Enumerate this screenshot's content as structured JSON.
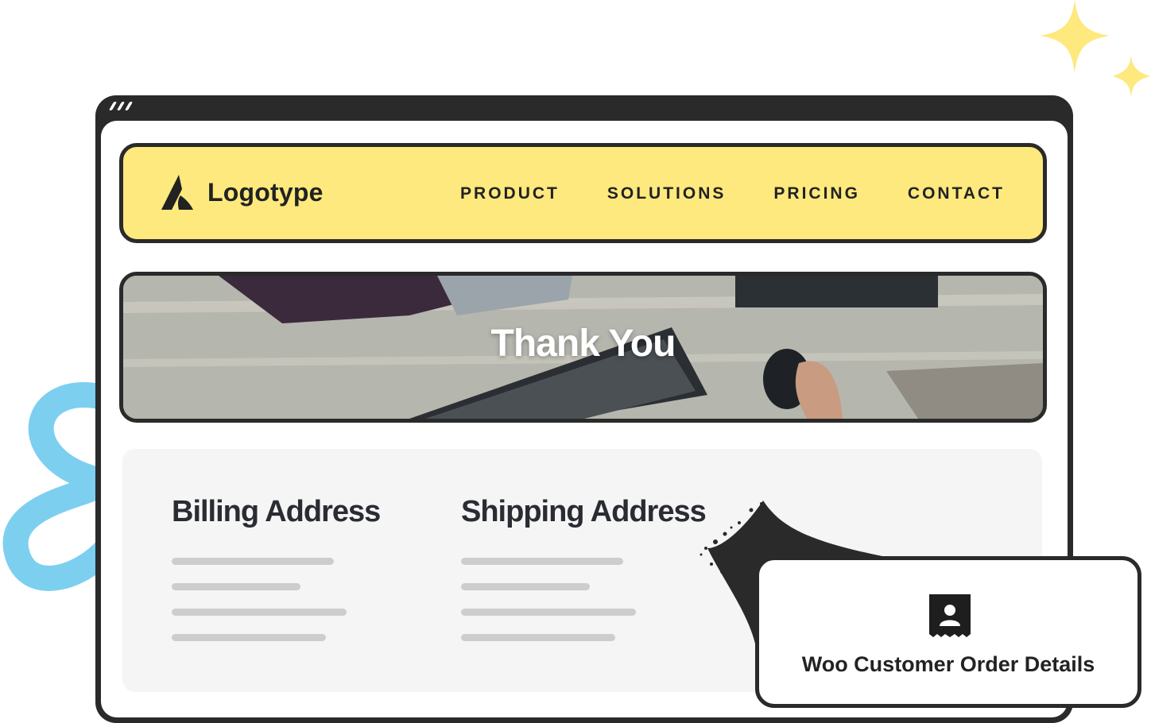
{
  "browser": {
    "window_dots": 3
  },
  "header": {
    "logo_text": "Logotype",
    "logo_icon": "logotype-mark-icon",
    "nav": [
      {
        "label": "PRODUCT"
      },
      {
        "label": "SOLUTIONS"
      },
      {
        "label": "PRICING"
      },
      {
        "label": "CONTACT"
      }
    ]
  },
  "hero": {
    "title": "Thank You",
    "background": "desk-keyboard-mouse-photo"
  },
  "addresses": {
    "billing": {
      "title": "Billing Address"
    },
    "shipping": {
      "title": "Shipping Address"
    }
  },
  "widget": {
    "label": "Woo Customer Order Details",
    "icon": "customer-receipt-icon"
  },
  "colors": {
    "nav_background": "#fde97d",
    "frame": "#2a2a2a",
    "panel": "#f5f5f5",
    "placeholder_lines": "#cdcdcd",
    "sparkle": "#fde97d",
    "squiggle": "#7dcfef"
  }
}
